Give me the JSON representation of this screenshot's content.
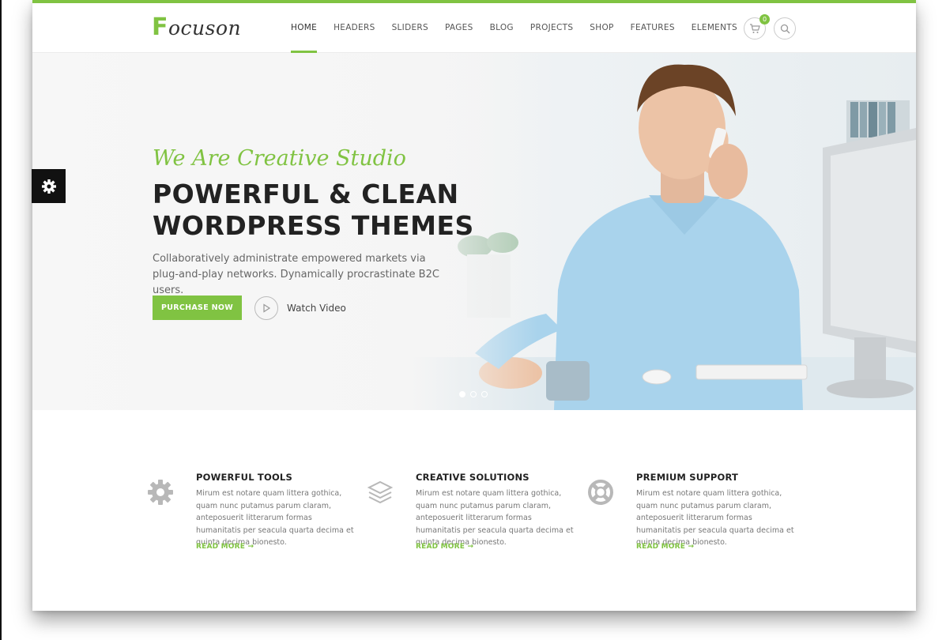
{
  "brand": {
    "logo_first": "F",
    "logo_rest": "ocuson"
  },
  "nav": {
    "items": [
      "HOME",
      "HEADERS",
      "SLIDERS",
      "PAGES",
      "BLOG",
      "PROJECTS",
      "SHOP",
      "FEATURES",
      "ELEMENTS"
    ],
    "active": "HOME"
  },
  "cart": {
    "count": "0"
  },
  "hero": {
    "tagline": "We Are Creative Studio",
    "headline_line1": "POWERFUL & CLEAN",
    "headline_line2": "WORDPRESS THEMES",
    "description": "Collaboratively administrate empowered markets via plug-and-play networks. Dynamically procrastinate B2C users.",
    "purchase_label": "PURCHASE NOW",
    "watch_label": "Watch Video",
    "slides": 3,
    "active_slide": 1
  },
  "features": [
    {
      "icon": "gear-icon",
      "title": "POWERFUL TOOLS",
      "text": "Mirum est notare quam littera gothica, quam nunc putamus parum claram, anteposuerit litterarum formas humanitatis per seacula quarta decima et quinta decima bionesto.",
      "link": "READ MORE →"
    },
    {
      "icon": "layers-icon",
      "title": "CREATIVE SOLUTIONS",
      "text": "Mirum est notare quam littera gothica, quam nunc putamus parum claram, anteposuerit litterarum formas humanitatis per seacula quarta decima et quinta decima bionesto.",
      "link": "READ MORE →"
    },
    {
      "icon": "lifebuoy-icon",
      "title": "PREMIUM SUPPORT",
      "text": "Mirum est notare quam littera gothica, quam nunc putamus parum claram, anteposuerit litterarum formas humanitatis per seacula quarta decima et quinta decima bionesto.",
      "link": "READ MORE →"
    }
  ],
  "colors": {
    "accent": "#80c342",
    "dark": "#222222",
    "muted": "#777777"
  }
}
